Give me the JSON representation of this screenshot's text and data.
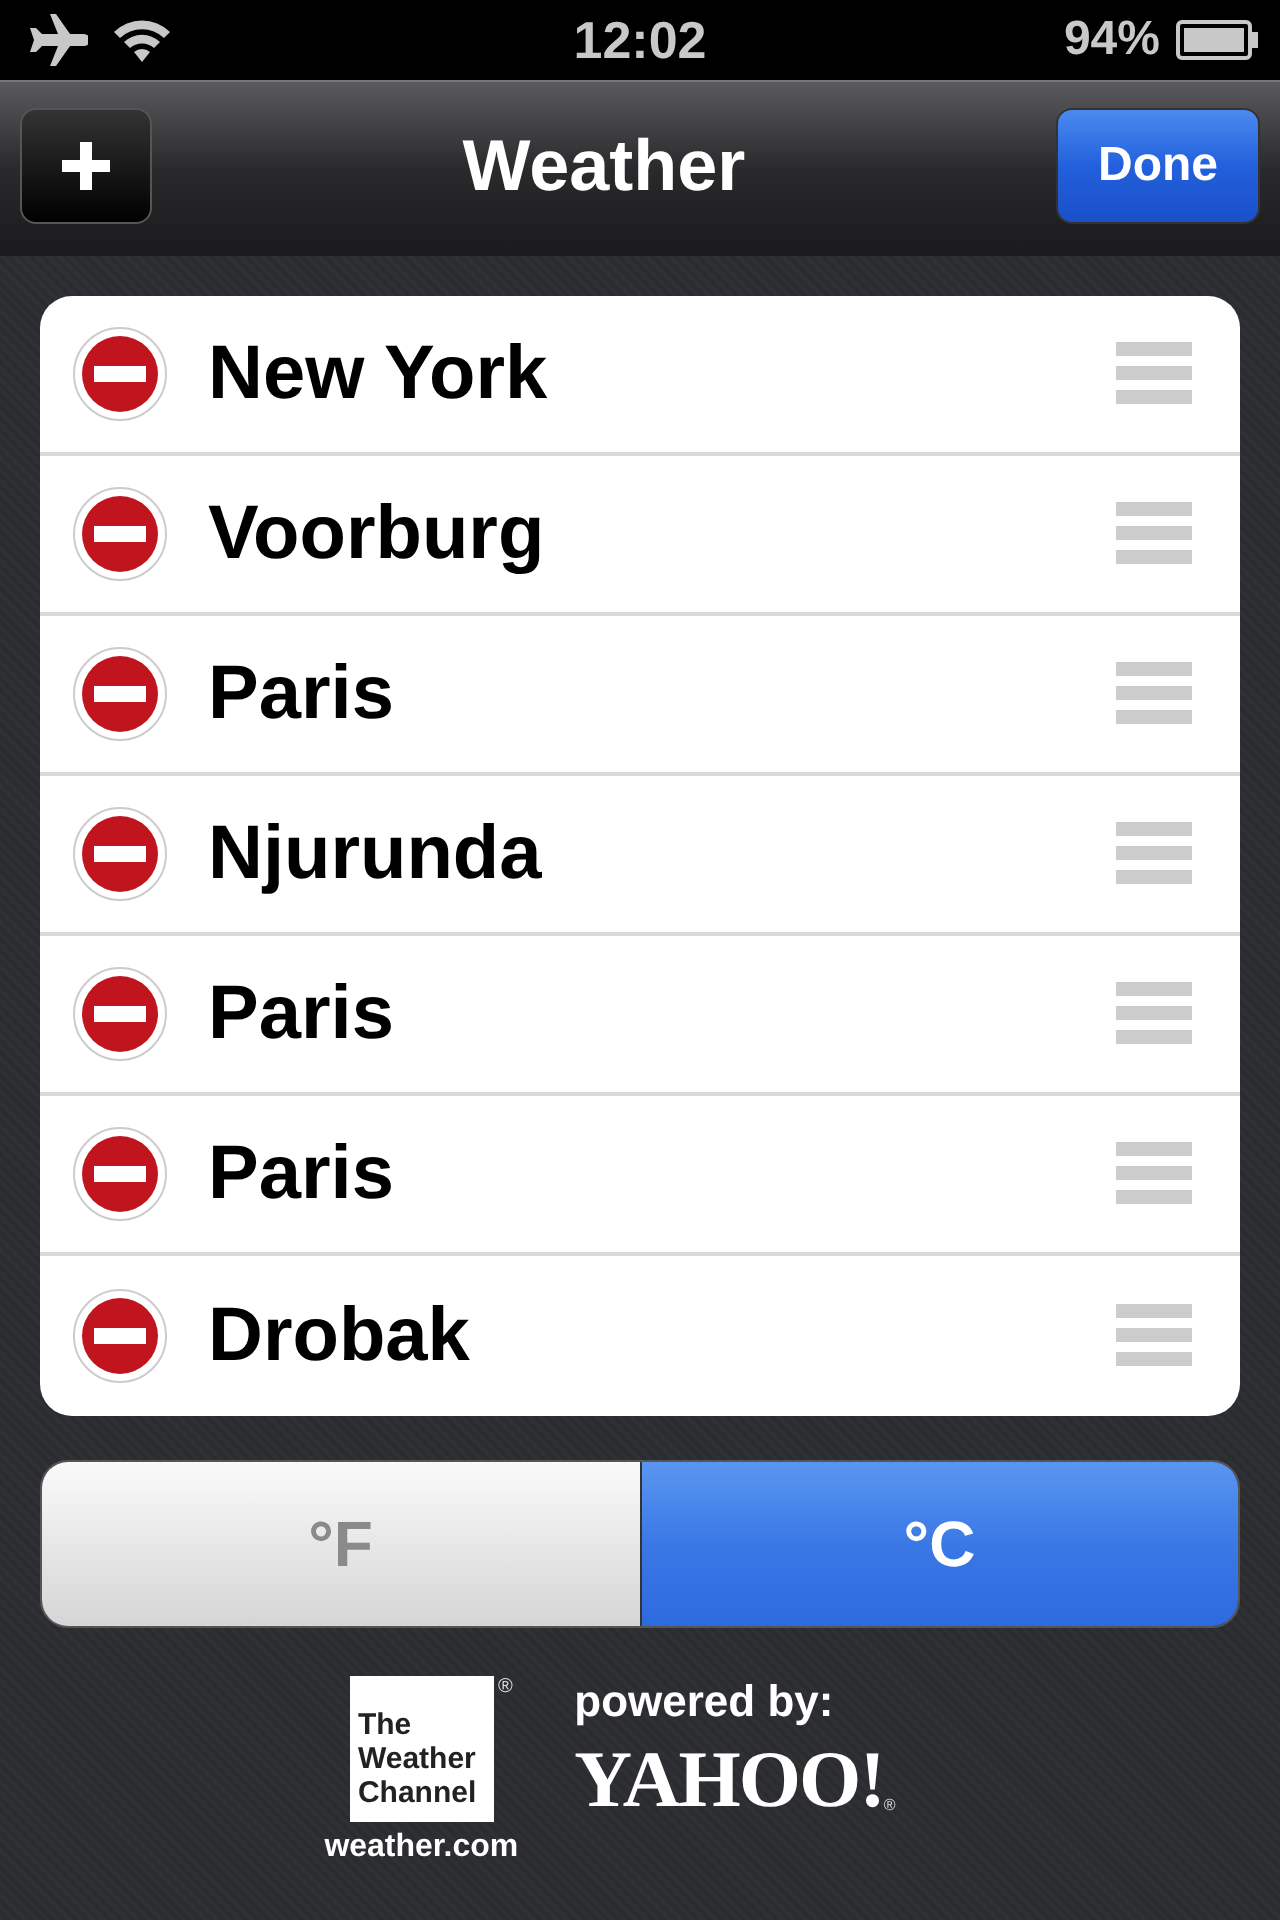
{
  "status_bar": {
    "time": "12:02",
    "battery": "94%"
  },
  "nav_bar": {
    "title": "Weather",
    "done_button": "Done"
  },
  "cities": [
    {
      "name": "New York"
    },
    {
      "name": "Voorburg"
    },
    {
      "name": "Paris"
    },
    {
      "name": "Njurunda"
    },
    {
      "name": "Paris"
    },
    {
      "name": "Paris"
    },
    {
      "name": "Drobak"
    }
  ],
  "units": [
    {
      "label": "°F",
      "selected": false
    },
    {
      "label": "°C",
      "selected": true
    }
  ],
  "footer": {
    "weather_channel_logo": [
      "The",
      "Weather",
      "Channel"
    ],
    "registered_mark": "®",
    "website": "weather.com",
    "powered_by": "powered by:",
    "yahoo_logo": "YAHOO!",
    "yahoo_mark": "®"
  }
}
